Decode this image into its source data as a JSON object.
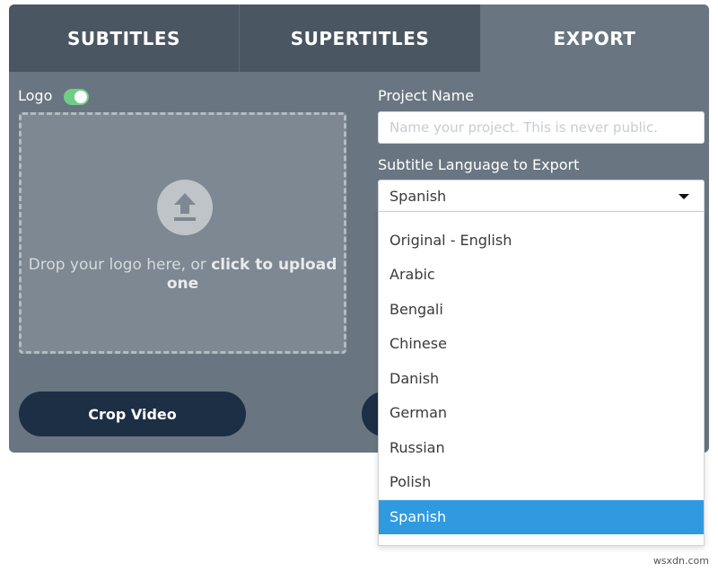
{
  "tabs": [
    {
      "label": "SUBTITLES"
    },
    {
      "label": "SUPERTITLES"
    },
    {
      "label": "EXPORT"
    }
  ],
  "logo": {
    "label": "Logo",
    "toggle_on": true,
    "drop_text_plain": "Drop your logo here, or ",
    "drop_text_bold": "click to upload one"
  },
  "buttons": {
    "crop_label": "Crop Video"
  },
  "project": {
    "label": "Project Name",
    "value": "",
    "placeholder": "Name your project. This is never public."
  },
  "language": {
    "label": "Subtitle Language to Export",
    "selected": "Spanish",
    "options": [
      "Original - English",
      "Arabic",
      "Bengali",
      "Chinese",
      "Danish",
      "German",
      "Russian",
      "Polish",
      "Spanish"
    ]
  },
  "colors": {
    "panel": "#697681",
    "tab_inactive": "#4a5661",
    "toggle": "#6fce85",
    "button": "#1c2f45",
    "selected_option": "#2f9ae0"
  },
  "watermark": "wsxdn.com"
}
